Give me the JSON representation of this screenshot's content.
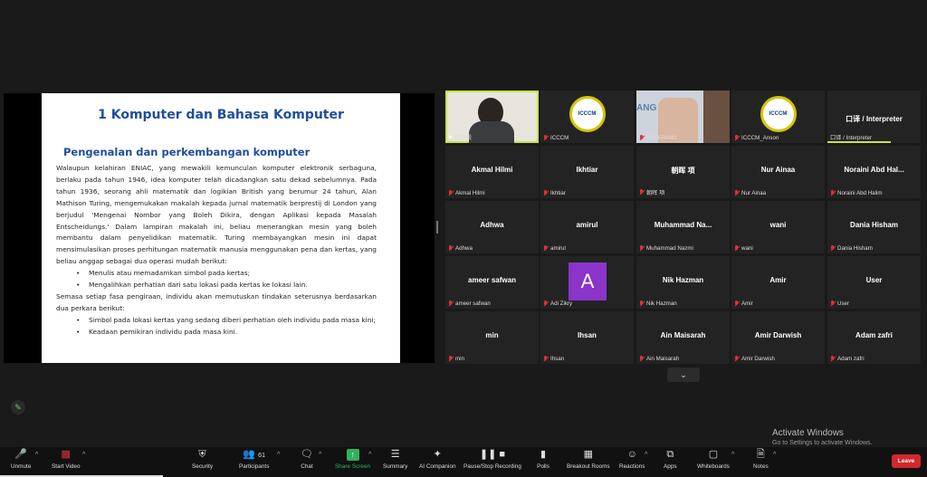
{
  "slide": {
    "title": "1 Komputer dan Bahasa Komputer",
    "subtitle": "Pengenalan dan perkembangan komputer",
    "para1": "Walaupun kelahiran ENIAC, yang mewakili kemunculan komputer elektronik serbaguna, berlaku pada tahun 1946, idea komputer telah dicadangkan satu dekad sebelumnya. Pada tahun 1936, seorang ahli matematik dan logikian British yang berumur 24 tahun, Alan Mathison Turing, mengemukakan makalah kepada jurnal matematik berprestij di London yang berjudul 'Mengenai Nombor yang Boleh Dikira, dengan Aplikasi kepada Masalah Entscheidungs.' Dalam lampiran makalah ini, beliau menerangkan mesin yang boleh membantu dalam penyelidikan matematik. Turing membayangkan mesin ini dapat mensimulasikan proses perhitungan matematik manusia menggunakan pena dan kertas, yang beliau anggap sebagai dua operasi mudah berikut:",
    "bullets1": [
      "Menulis atau memadamkan simbol pada kertas;",
      "Mengalihkan perhatian dari satu lokasi pada kertas ke lokasi lain."
    ],
    "para2": "Semasa setiap fasa pengiraan, individu akan memutuskan tindakan seterusnya berdasarkan dua perkara berikut:",
    "bullets2": [
      "Simbol pada lokasi kertas yang sedang diberi perhatian oleh individu pada masa kini;",
      "Keadaan pemikiran individu pada masa kini."
    ]
  },
  "tiles": [
    {
      "name": "",
      "label": "邱健毅",
      "kind": "video-person",
      "active": true,
      "pinned": true
    },
    {
      "name": "",
      "label": "ICCCM",
      "kind": "logo",
      "logo_text": "ICCCM"
    },
    {
      "name": "",
      "label": "KVSEPANG",
      "kind": "video-room",
      "room_text": "ANG"
    },
    {
      "name": "",
      "label": "ICCCM_Anson",
      "kind": "logo",
      "logo_text": "ICCCM"
    },
    {
      "name": "口译 / Interpreter",
      "label": "口译 / Interpreter",
      "kind": "name"
    },
    {
      "name": "Akmal Hilmi",
      "label": "Akmal Hilmi",
      "kind": "name"
    },
    {
      "name": "Ikhtiar",
      "label": "Ikhtiar",
      "kind": "name"
    },
    {
      "name": "朝晖 项",
      "label": "朝晖 项",
      "kind": "name"
    },
    {
      "name": "Nur Ainaa",
      "label": "Nur Ainaa",
      "kind": "name"
    },
    {
      "name": "Noraini Abd Hal...",
      "label": "Noraini Abd Halim",
      "kind": "name"
    },
    {
      "name": "Adhwa",
      "label": "Adhwa",
      "kind": "name"
    },
    {
      "name": "amirul",
      "label": "amirul",
      "kind": "name"
    },
    {
      "name": "Muhammad Na...",
      "label": "Muhammad Nazmi",
      "kind": "name"
    },
    {
      "name": "wani",
      "label": "wani",
      "kind": "name"
    },
    {
      "name": "Dania Hisham",
      "label": "Dania Hisham",
      "kind": "name"
    },
    {
      "name": "ameer safwan",
      "label": "ameer safwan",
      "kind": "name"
    },
    {
      "name": "",
      "label": "Adi Zikry",
      "kind": "avatar",
      "avatar_letter": "A"
    },
    {
      "name": "Nik Hazman",
      "label": "Nik Hazman",
      "kind": "name"
    },
    {
      "name": "Amir",
      "label": "Amir",
      "kind": "name"
    },
    {
      "name": "User",
      "label": "User",
      "kind": "name"
    },
    {
      "name": "min",
      "label": "min",
      "kind": "name"
    },
    {
      "name": "Ihsan",
      "label": "Ihsan",
      "kind": "name"
    },
    {
      "name": "Ain Maisarah",
      "label": "Ain Maisarah",
      "kind": "name"
    },
    {
      "name": "Amir Darwish",
      "label": "Amir Darwish",
      "kind": "name"
    },
    {
      "name": "Adam zafri",
      "label": "Adam zafri",
      "kind": "name"
    }
  ],
  "toolbar": {
    "unmute": "Unmute",
    "start_video": "Start Video",
    "security": "Security",
    "participants": "Participants",
    "participants_count": "61",
    "chat": "Chat",
    "share_screen": "Share Screen",
    "summary": "Summary",
    "ai_companion": "AI Companion",
    "pause_recording": "Pause/Stop Recording",
    "polls": "Polls",
    "breakout_rooms": "Breakout Rooms",
    "reactions": "Reactions",
    "apps": "Apps",
    "whiteboards": "Whiteboards",
    "notes": "Notes",
    "leave": "Leave"
  },
  "watermark": {
    "title": "Activate Windows",
    "subtitle": "Go to Settings to activate Windows."
  },
  "colors": {
    "accent_green": "#c6e63c",
    "leave_red": "#d2282d",
    "share_green": "#2fb35a",
    "slide_blue": "#1f4e9c",
    "avatar_purple": "#8a34c9"
  }
}
